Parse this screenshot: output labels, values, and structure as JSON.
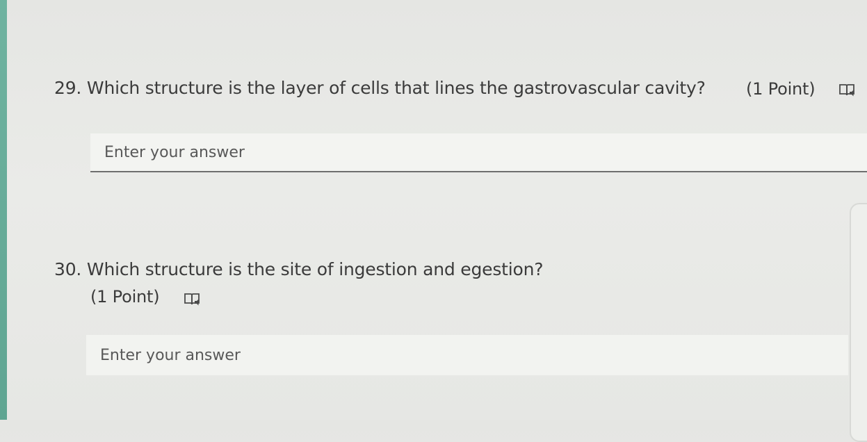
{
  "questions": [
    {
      "number": "29.",
      "text": "Which structure is the layer of cells that lines the gastrovascular cavity?",
      "points": "(1 Point)",
      "icon": "immersive-reader-icon",
      "answer": {
        "placeholder": "Enter your answer",
        "value": ""
      }
    },
    {
      "number": "30.",
      "text": "Which structure is the site of ingestion and egestion?",
      "points": "(1 Point)",
      "icon": "immersive-reader-icon",
      "answer": {
        "placeholder": "Enter your answer",
        "value": ""
      }
    }
  ],
  "colors": {
    "background": "#e8e9e6",
    "accent": "#5fa592",
    "text": "#3b3b3b",
    "input_background": "#f3f4f1",
    "input_underline": "#6e6e6e"
  }
}
